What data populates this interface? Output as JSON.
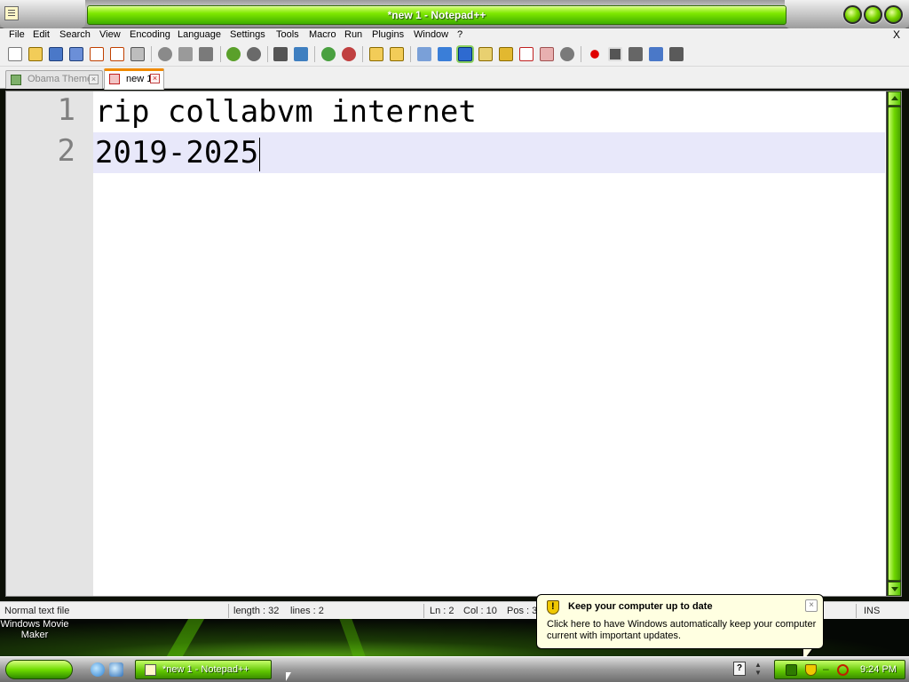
{
  "window": {
    "title": "*new 1 - Notepad++"
  },
  "menu": {
    "items": [
      "File",
      "Edit",
      "Search",
      "View",
      "Encoding",
      "Language",
      "Settings",
      "Tools",
      "Macro",
      "Run",
      "Plugins",
      "Window",
      "?"
    ],
    "close": "X"
  },
  "toolbar": {
    "icons": [
      "new-file-icon",
      "open-file-icon",
      "save-icon",
      "save-all-icon",
      "close-icon",
      "close-all-icon",
      "print-icon",
      "cut-icon",
      "copy-icon",
      "paste-icon",
      "undo-icon",
      "redo-icon",
      "find-icon",
      "replace-icon",
      "zoom-in-icon",
      "zoom-out-icon",
      "sync-vertical-icon",
      "sync-horizontal-icon",
      "word-wrap-icon",
      "show-all-chars-icon",
      "indent-guide-icon",
      "user-language-icon",
      "document-map-icon",
      "function-list-icon",
      "folder-workspace-icon",
      "monitoring-icon",
      "record-macro-icon",
      "stop-macro-icon",
      "play-macro-icon",
      "run-macro-multiple-icon",
      "save-macro-icon"
    ]
  },
  "tabs": [
    {
      "label": "Obama Theme",
      "active": false
    },
    {
      "label": "new 1",
      "active": true
    }
  ],
  "editor": {
    "lines": [
      {
        "number": "1",
        "text": "rip collabvm internet"
      },
      {
        "number": "2",
        "text": "2019-2025"
      }
    ],
    "current_line": 2
  },
  "status": {
    "file_type": "Normal text file",
    "length": "length : 32",
    "lines": "lines : 2",
    "ln": "Ln : 2",
    "col": "Col : 10",
    "pos": "Pos : 3",
    "mode": "INS"
  },
  "desktop": {
    "icon_label": "Windows Movie Maker"
  },
  "balloon": {
    "title": "Keep your computer up to date",
    "text": "Click here to have Windows automatically keep your computer current with important updates.",
    "close": "×"
  },
  "taskbar": {
    "task_label": "*new 1 - Notepad++",
    "clock": "9:24 PM",
    "help_glyph": "?"
  },
  "colors": {
    "accent_green": "#6fdc00",
    "current_line_highlight": "#e8e8fa",
    "balloon_bg": "#ffffe1"
  }
}
